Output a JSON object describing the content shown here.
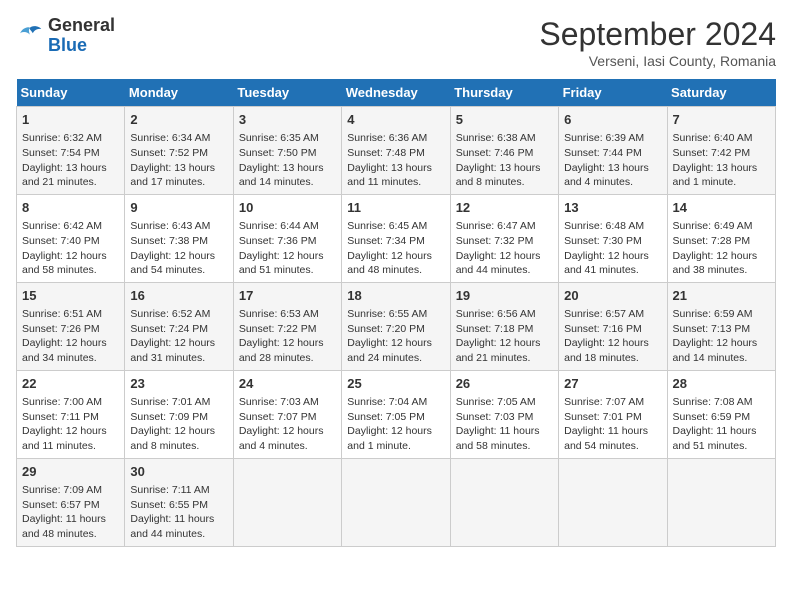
{
  "header": {
    "logo_general": "General",
    "logo_blue": "Blue",
    "month_title": "September 2024",
    "subtitle": "Verseni, Iasi County, Romania"
  },
  "weekdays": [
    "Sunday",
    "Monday",
    "Tuesday",
    "Wednesday",
    "Thursday",
    "Friday",
    "Saturday"
  ],
  "weeks": [
    [
      {
        "day": "1",
        "info": "Sunrise: 6:32 AM\nSunset: 7:54 PM\nDaylight: 13 hours\nand 21 minutes."
      },
      {
        "day": "2",
        "info": "Sunrise: 6:34 AM\nSunset: 7:52 PM\nDaylight: 13 hours\nand 17 minutes."
      },
      {
        "day": "3",
        "info": "Sunrise: 6:35 AM\nSunset: 7:50 PM\nDaylight: 13 hours\nand 14 minutes."
      },
      {
        "day": "4",
        "info": "Sunrise: 6:36 AM\nSunset: 7:48 PM\nDaylight: 13 hours\nand 11 minutes."
      },
      {
        "day": "5",
        "info": "Sunrise: 6:38 AM\nSunset: 7:46 PM\nDaylight: 13 hours\nand 8 minutes."
      },
      {
        "day": "6",
        "info": "Sunrise: 6:39 AM\nSunset: 7:44 PM\nDaylight: 13 hours\nand 4 minutes."
      },
      {
        "day": "7",
        "info": "Sunrise: 6:40 AM\nSunset: 7:42 PM\nDaylight: 13 hours\nand 1 minute."
      }
    ],
    [
      {
        "day": "8",
        "info": "Sunrise: 6:42 AM\nSunset: 7:40 PM\nDaylight: 12 hours\nand 58 minutes."
      },
      {
        "day": "9",
        "info": "Sunrise: 6:43 AM\nSunset: 7:38 PM\nDaylight: 12 hours\nand 54 minutes."
      },
      {
        "day": "10",
        "info": "Sunrise: 6:44 AM\nSunset: 7:36 PM\nDaylight: 12 hours\nand 51 minutes."
      },
      {
        "day": "11",
        "info": "Sunrise: 6:45 AM\nSunset: 7:34 PM\nDaylight: 12 hours\nand 48 minutes."
      },
      {
        "day": "12",
        "info": "Sunrise: 6:47 AM\nSunset: 7:32 PM\nDaylight: 12 hours\nand 44 minutes."
      },
      {
        "day": "13",
        "info": "Sunrise: 6:48 AM\nSunset: 7:30 PM\nDaylight: 12 hours\nand 41 minutes."
      },
      {
        "day": "14",
        "info": "Sunrise: 6:49 AM\nSunset: 7:28 PM\nDaylight: 12 hours\nand 38 minutes."
      }
    ],
    [
      {
        "day": "15",
        "info": "Sunrise: 6:51 AM\nSunset: 7:26 PM\nDaylight: 12 hours\nand 34 minutes."
      },
      {
        "day": "16",
        "info": "Sunrise: 6:52 AM\nSunset: 7:24 PM\nDaylight: 12 hours\nand 31 minutes."
      },
      {
        "day": "17",
        "info": "Sunrise: 6:53 AM\nSunset: 7:22 PM\nDaylight: 12 hours\nand 28 minutes."
      },
      {
        "day": "18",
        "info": "Sunrise: 6:55 AM\nSunset: 7:20 PM\nDaylight: 12 hours\nand 24 minutes."
      },
      {
        "day": "19",
        "info": "Sunrise: 6:56 AM\nSunset: 7:18 PM\nDaylight: 12 hours\nand 21 minutes."
      },
      {
        "day": "20",
        "info": "Sunrise: 6:57 AM\nSunset: 7:16 PM\nDaylight: 12 hours\nand 18 minutes."
      },
      {
        "day": "21",
        "info": "Sunrise: 6:59 AM\nSunset: 7:13 PM\nDaylight: 12 hours\nand 14 minutes."
      }
    ],
    [
      {
        "day": "22",
        "info": "Sunrise: 7:00 AM\nSunset: 7:11 PM\nDaylight: 12 hours\nand 11 minutes."
      },
      {
        "day": "23",
        "info": "Sunrise: 7:01 AM\nSunset: 7:09 PM\nDaylight: 12 hours\nand 8 minutes."
      },
      {
        "day": "24",
        "info": "Sunrise: 7:03 AM\nSunset: 7:07 PM\nDaylight: 12 hours\nand 4 minutes."
      },
      {
        "day": "25",
        "info": "Sunrise: 7:04 AM\nSunset: 7:05 PM\nDaylight: 12 hours\nand 1 minute."
      },
      {
        "day": "26",
        "info": "Sunrise: 7:05 AM\nSunset: 7:03 PM\nDaylight: 11 hours\nand 58 minutes."
      },
      {
        "day": "27",
        "info": "Sunrise: 7:07 AM\nSunset: 7:01 PM\nDaylight: 11 hours\nand 54 minutes."
      },
      {
        "day": "28",
        "info": "Sunrise: 7:08 AM\nSunset: 6:59 PM\nDaylight: 11 hours\nand 51 minutes."
      }
    ],
    [
      {
        "day": "29",
        "info": "Sunrise: 7:09 AM\nSunset: 6:57 PM\nDaylight: 11 hours\nand 48 minutes."
      },
      {
        "day": "30",
        "info": "Sunrise: 7:11 AM\nSunset: 6:55 PM\nDaylight: 11 hours\nand 44 minutes."
      },
      {
        "day": "",
        "info": ""
      },
      {
        "day": "",
        "info": ""
      },
      {
        "day": "",
        "info": ""
      },
      {
        "day": "",
        "info": ""
      },
      {
        "day": "",
        "info": ""
      }
    ]
  ]
}
